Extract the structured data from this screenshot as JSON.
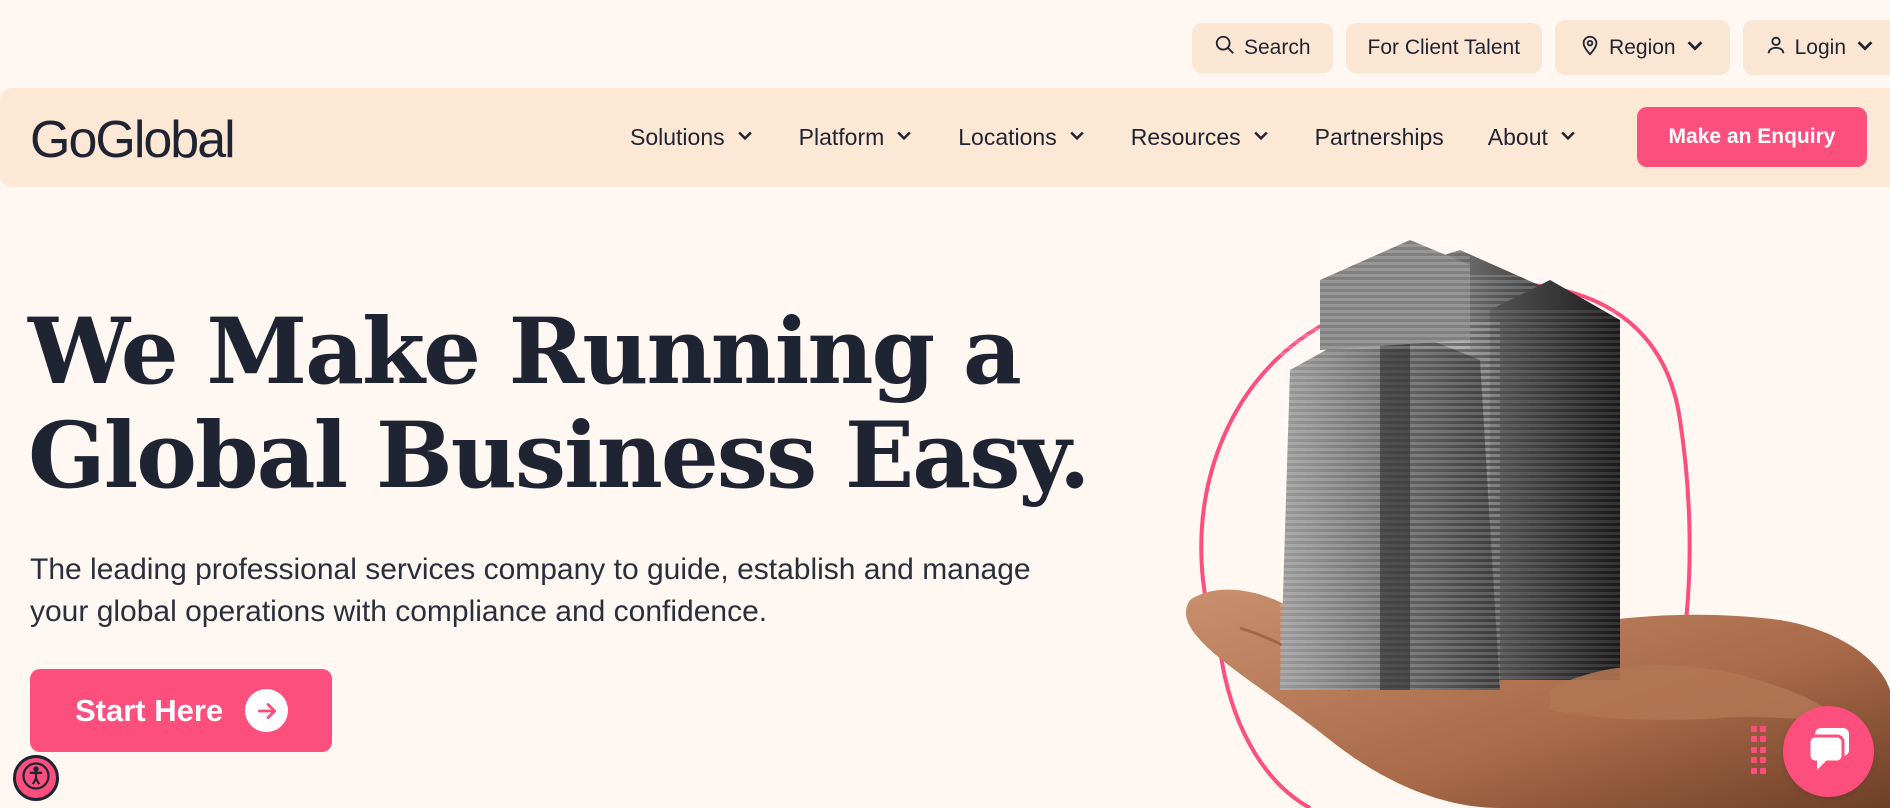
{
  "utility": {
    "search": "Search",
    "client_talent": "For Client Talent",
    "region": "Region",
    "login": "Login"
  },
  "brand": {
    "logo": "GoGlobal"
  },
  "nav": {
    "items": [
      {
        "label": "Solutions",
        "dropdown": true
      },
      {
        "label": "Platform",
        "dropdown": true
      },
      {
        "label": "Locations",
        "dropdown": true
      },
      {
        "label": "Resources",
        "dropdown": true
      },
      {
        "label": "Partnerships",
        "dropdown": false
      },
      {
        "label": "About",
        "dropdown": true
      }
    ],
    "cta": "Make an Enquiry"
  },
  "hero": {
    "headline_line1": "We Make Running a",
    "headline_line2": "Global Business Easy.",
    "subtext_line1": "The leading professional services company to guide, establish and manage",
    "subtext_line2": "your global operations with compliance and confidence.",
    "button": "Start Here"
  },
  "colors": {
    "accent": "#fd4f7d",
    "nav_bg": "#fde8d6",
    "page_bg": "#fff7f1",
    "text": "#1f2433"
  },
  "icons": {
    "search": "search-icon",
    "region": "location-pin-icon",
    "login": "user-icon",
    "arrow": "arrow-right-icon",
    "accessibility": "accessibility-icon",
    "chat": "chat-icon"
  }
}
